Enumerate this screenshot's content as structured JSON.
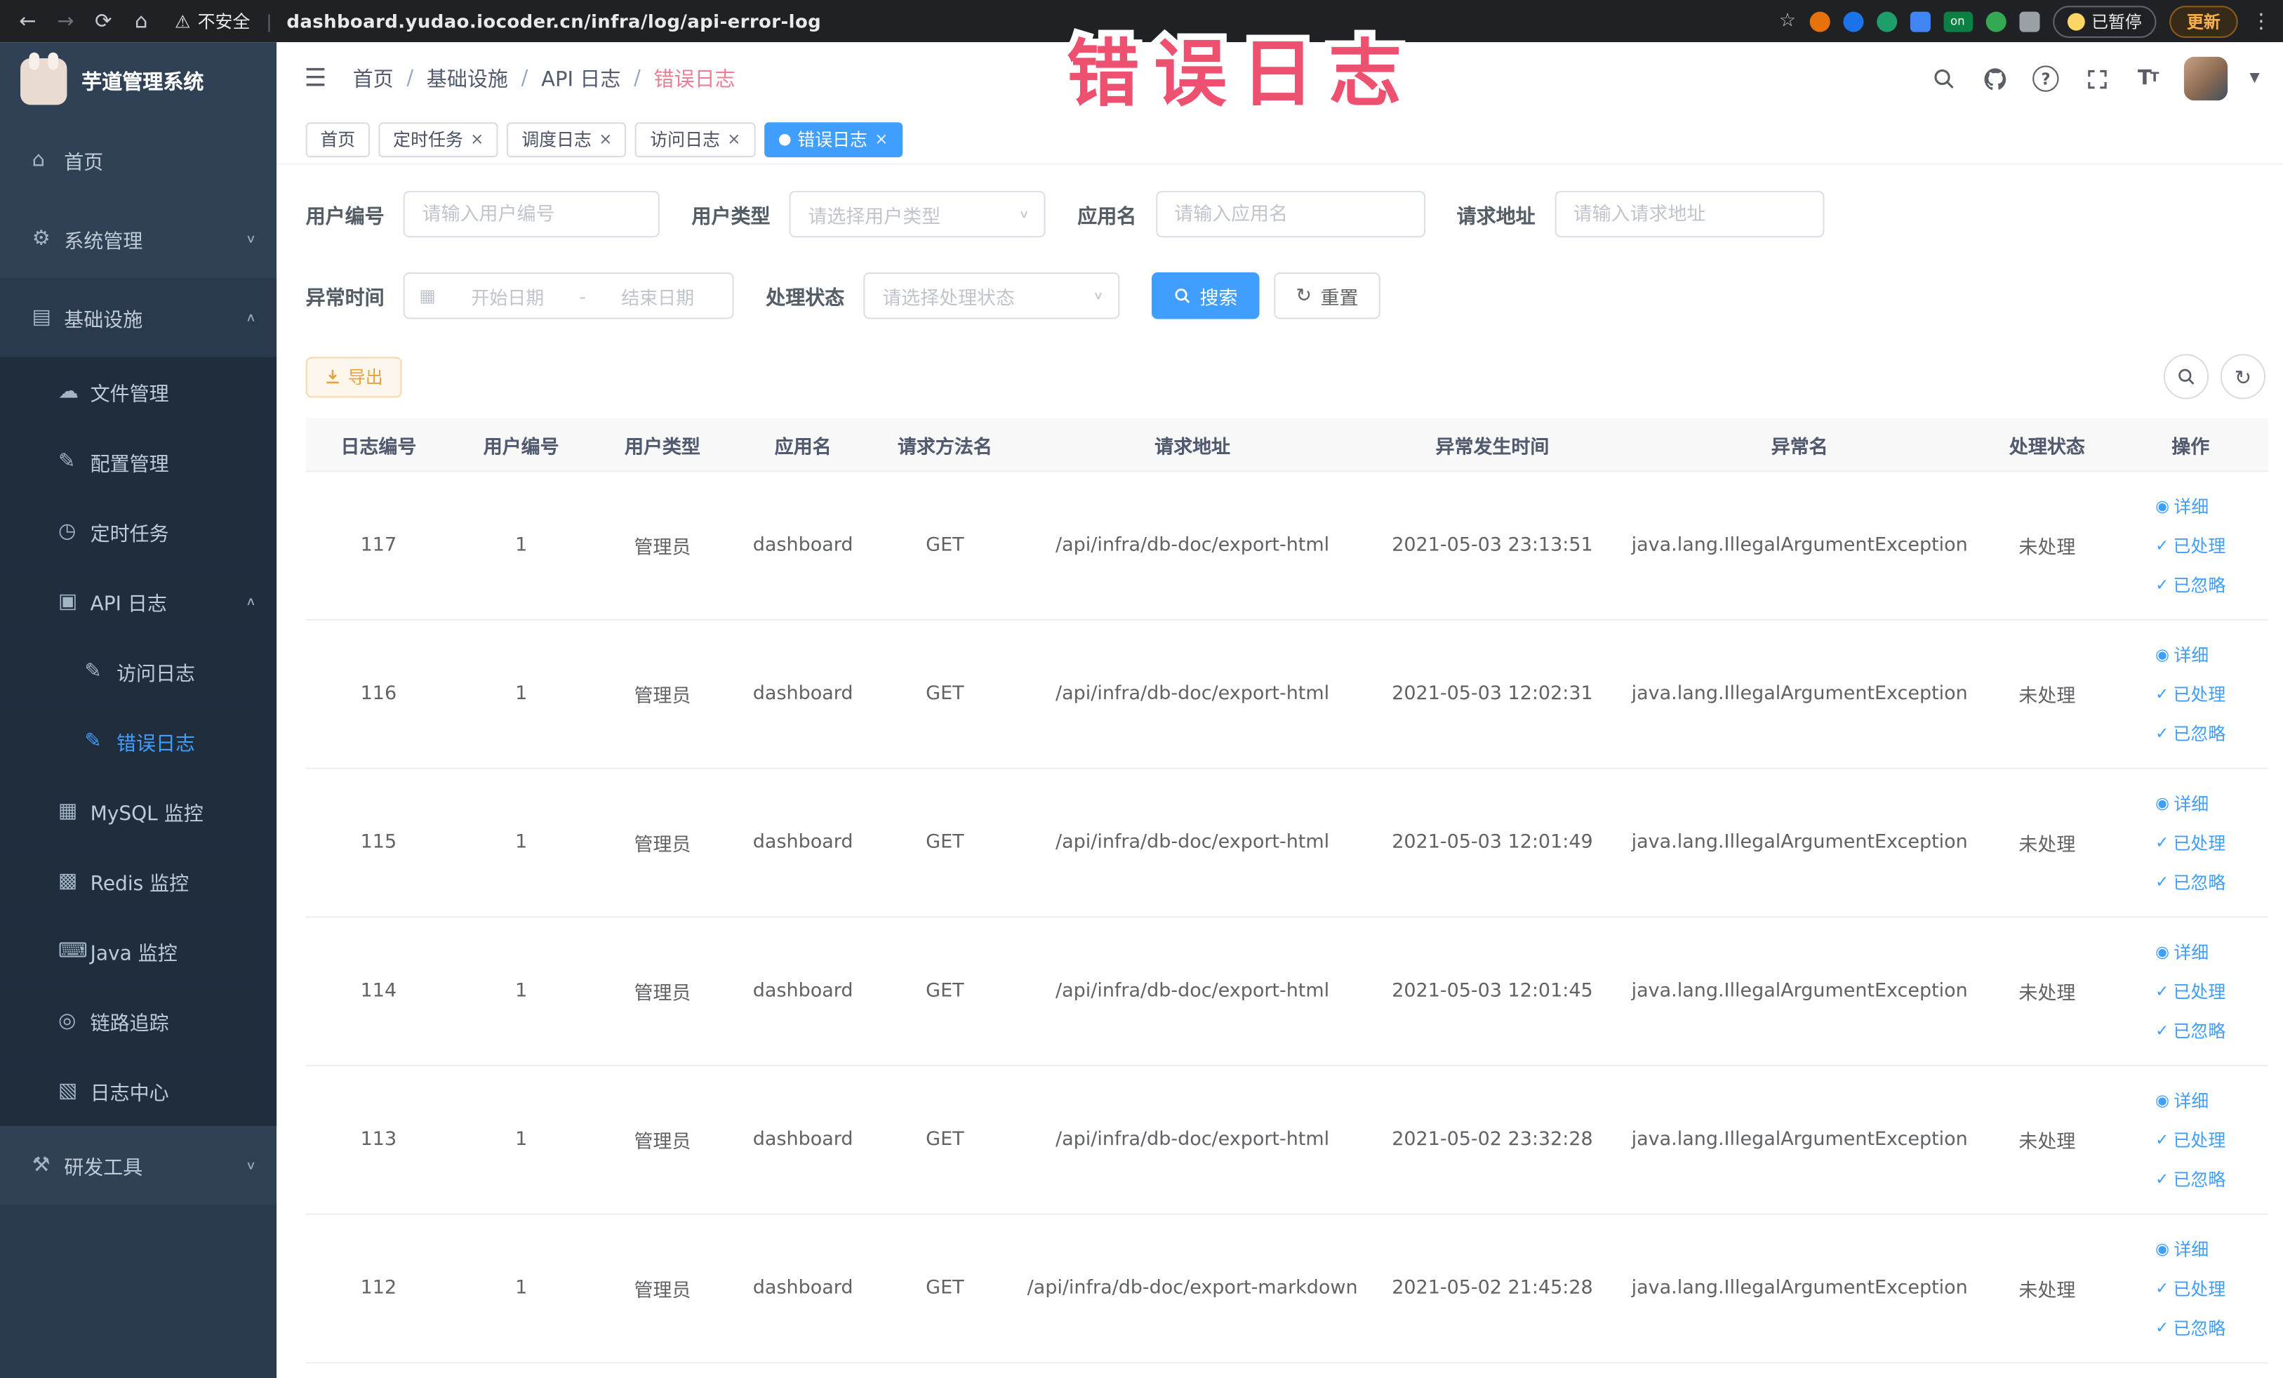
{
  "colors": {
    "primary": "#409eff",
    "sidebar_bg": "#304156",
    "submenu_bg": "#1f2d3d",
    "annotation_pink": "#ee5170",
    "export_warning": "#e6a23c",
    "chrome_bg": "#202124"
  },
  "browser": {
    "security_label": "不安全",
    "url": "dashboard.yudao.iocoder.cn/infra/log/api-error-log",
    "extension_on_badge": "on",
    "paused_badge": "已暂停",
    "update_label": "更新"
  },
  "annotation": {
    "text": "错误日志"
  },
  "sidebar": {
    "logo_title": "芋道管理系统",
    "items": [
      {
        "label": "首页",
        "icon": "⌂"
      },
      {
        "label": "系统管理",
        "icon": "⚙"
      },
      {
        "label": "基础设施",
        "icon": "▤"
      },
      {
        "label": "文件管理",
        "icon": "☁"
      },
      {
        "label": "配置管理",
        "icon": "✎"
      },
      {
        "label": "定时任务",
        "icon": "◷"
      },
      {
        "label": "API 日志",
        "icon": "▣"
      },
      {
        "label": "访问日志",
        "icon": "✎"
      },
      {
        "label": "错误日志",
        "icon": "✎"
      },
      {
        "label": "MySQL 监控",
        "icon": "▦"
      },
      {
        "label": "Redis 监控",
        "icon": "▩"
      },
      {
        "label": "Java 监控",
        "icon": "⌨"
      },
      {
        "label": "链路追踪",
        "icon": "◎"
      },
      {
        "label": "日志中心",
        "icon": "▧"
      },
      {
        "label": "研发工具",
        "icon": "⚒"
      }
    ]
  },
  "navbar": {
    "breadcrumb": [
      "首页",
      "基础设施",
      "API 日志",
      "错误日志"
    ]
  },
  "tabs": [
    {
      "label": "首页"
    },
    {
      "label": "定时任务"
    },
    {
      "label": "调度日志"
    },
    {
      "label": "访问日志"
    },
    {
      "label": "错误日志"
    }
  ],
  "filters": {
    "user_id": {
      "label": "用户编号",
      "placeholder": "请输入用户编号"
    },
    "user_type": {
      "label": "用户类型",
      "placeholder": "请选择用户类型"
    },
    "app_name": {
      "label": "应用名",
      "placeholder": "请输入应用名"
    },
    "request_url": {
      "label": "请求地址",
      "placeholder": "请输入请求地址"
    },
    "exception_time": {
      "label": "异常时间",
      "start_placeholder": "开始日期",
      "separator": "-",
      "end_placeholder": "结束日期"
    },
    "process_status": {
      "label": "处理状态",
      "placeholder": "请选择处理状态"
    },
    "search_label": "搜索",
    "reset_label": "重置"
  },
  "toolbar": {
    "export_label": "导出"
  },
  "table": {
    "columns": [
      "日志编号",
      "用户编号",
      "用户类型",
      "应用名",
      "请求方法名",
      "请求地址",
      "异常发生时间",
      "异常名",
      "处理状态",
      "操作"
    ],
    "rows": [
      {
        "id": "117",
        "user_id": "1",
        "user_type": "管理员",
        "app_name": "dashboard",
        "method": "GET",
        "url": "/api/infra/db-doc/export-html",
        "time": "2021-05-03 23:13:51",
        "exception": "java.lang.IllegalArgumentException",
        "status": "未处理"
      },
      {
        "id": "116",
        "user_id": "1",
        "user_type": "管理员",
        "app_name": "dashboard",
        "method": "GET",
        "url": "/api/infra/db-doc/export-html",
        "time": "2021-05-03 12:02:31",
        "exception": "java.lang.IllegalArgumentException",
        "status": "未处理"
      },
      {
        "id": "115",
        "user_id": "1",
        "user_type": "管理员",
        "app_name": "dashboard",
        "method": "GET",
        "url": "/api/infra/db-doc/export-html",
        "time": "2021-05-03 12:01:49",
        "exception": "java.lang.IllegalArgumentException",
        "status": "未处理"
      },
      {
        "id": "114",
        "user_id": "1",
        "user_type": "管理员",
        "app_name": "dashboard",
        "method": "GET",
        "url": "/api/infra/db-doc/export-html",
        "time": "2021-05-03 12:01:45",
        "exception": "java.lang.IllegalArgumentException",
        "status": "未处理"
      },
      {
        "id": "113",
        "user_id": "1",
        "user_type": "管理员",
        "app_name": "dashboard",
        "method": "GET",
        "url": "/api/infra/db-doc/export-html",
        "time": "2021-05-02 23:32:28",
        "exception": "java.lang.IllegalArgumentException",
        "status": "未处理"
      },
      {
        "id": "112",
        "user_id": "1",
        "user_type": "管理员",
        "app_name": "dashboard",
        "method": "GET",
        "url": "/api/infra/db-doc/export-markdown",
        "time": "2021-05-02 21:45:28",
        "exception": "java.lang.IllegalArgumentException",
        "status": "未处理"
      }
    ],
    "actions": {
      "detail": "详细",
      "processed": "已处理",
      "ignored": "已忽略"
    }
  }
}
